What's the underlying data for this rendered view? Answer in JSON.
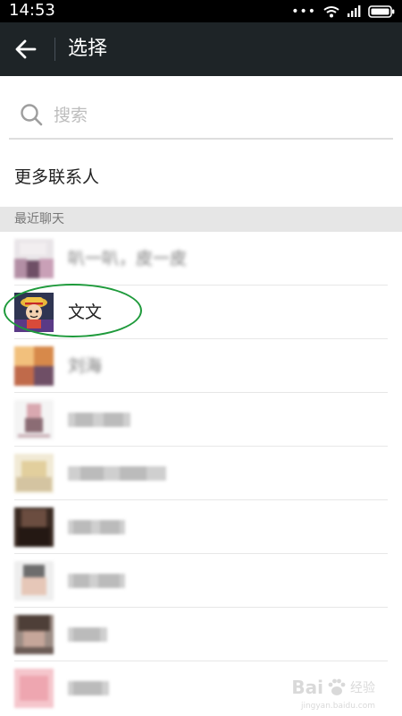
{
  "status_bar": {
    "time": "14:53"
  },
  "app_bar": {
    "title": "选择"
  },
  "search": {
    "placeholder": "搜索"
  },
  "more_contacts": "更多联系人",
  "section_header": "最近聊天",
  "chats": [
    {
      "name": "叭一叭，皮一皮",
      "blurred": true
    },
    {
      "name": "文文",
      "blurred": false,
      "highlighted": true
    },
    {
      "name": "刘海",
      "blurred": true
    },
    {
      "name": "",
      "blurred": true
    },
    {
      "name": "",
      "blurred": true
    },
    {
      "name": "",
      "blurred": true
    },
    {
      "name": "",
      "blurred": true
    },
    {
      "name": "",
      "blurred": true
    },
    {
      "name": "",
      "blurred": true
    }
  ],
  "colors": {
    "app_bar_bg": "#1e2427",
    "highlight_ring": "#1e9a3b"
  },
  "watermark": {
    "brand": "Bai",
    "brand_tail": "经验",
    "url": "jingyan.baidu.com"
  }
}
